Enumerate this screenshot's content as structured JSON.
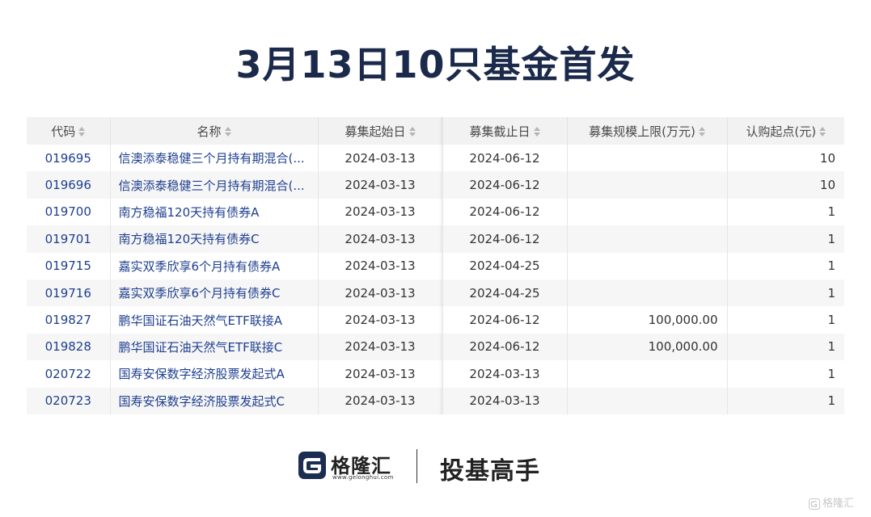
{
  "title": "3月13日10只基金首发",
  "table": {
    "columns": [
      "代码",
      "名称",
      "募集起始日",
      "募集截止日",
      "募集规模上限(万元)",
      "认购起点(元)"
    ],
    "rows": [
      {
        "code": "019695",
        "name": "信澳添泰稳健三个月持有期混合(...",
        "start": "2024-03-13",
        "end": "2024-06-12",
        "cap": "",
        "min": "10"
      },
      {
        "code": "019696",
        "name": "信澳添泰稳健三个月持有期混合(...",
        "start": "2024-03-13",
        "end": "2024-06-12",
        "cap": "",
        "min": "10"
      },
      {
        "code": "019700",
        "name": "南方稳福120天持有债券A",
        "start": "2024-03-13",
        "end": "2024-06-12",
        "cap": "",
        "min": "1"
      },
      {
        "code": "019701",
        "name": "南方稳福120天持有债券C",
        "start": "2024-03-13",
        "end": "2024-06-12",
        "cap": "",
        "min": "1"
      },
      {
        "code": "019715",
        "name": "嘉实双季欣享6个月持有债券A",
        "start": "2024-03-13",
        "end": "2024-04-25",
        "cap": "",
        "min": "1"
      },
      {
        "code": "019716",
        "name": "嘉实双季欣享6个月持有债券C",
        "start": "2024-03-13",
        "end": "2024-04-25",
        "cap": "",
        "min": "1"
      },
      {
        "code": "019827",
        "name": "鹏华国证石油天然气ETF联接A",
        "start": "2024-03-13",
        "end": "2024-06-12",
        "cap": "100,000.00",
        "min": "1"
      },
      {
        "code": "019828",
        "name": "鹏华国证石油天然气ETF联接C",
        "start": "2024-03-13",
        "end": "2024-06-12",
        "cap": "100,000.00",
        "min": "1"
      },
      {
        "code": "020722",
        "name": "国寿安保数字经济股票发起式A",
        "start": "2024-03-13",
        "end": "2024-03-13",
        "cap": "",
        "min": "1"
      },
      {
        "code": "020723",
        "name": "国寿安保数字经济股票发起式C",
        "start": "2024-03-13",
        "end": "2024-03-13",
        "cap": "",
        "min": "1"
      }
    ]
  },
  "footer": {
    "brand": "格隆汇",
    "brand_url": "www.gelonghui.com",
    "slogan": "投基高手",
    "logo_icon": "gelonghui-logo-icon"
  },
  "watermark": {
    "text": "格隆汇",
    "icon": "gelonghui-logo-icon"
  },
  "colors": {
    "title": "#1b2a4a",
    "link": "#1e3f8f",
    "header_bg": "#f2f2f2",
    "stripe_bg": "#f6f6f6"
  }
}
